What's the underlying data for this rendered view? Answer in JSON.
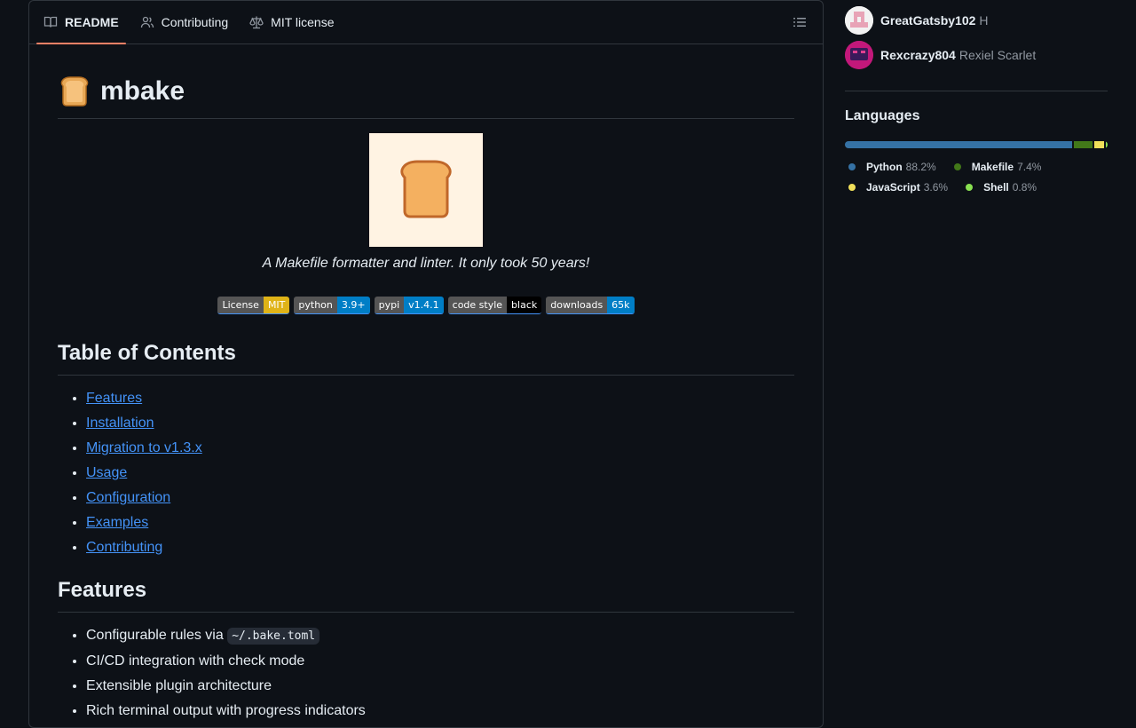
{
  "tabs": [
    {
      "label": "README",
      "icon": "book-icon",
      "active": true
    },
    {
      "label": "Contributing",
      "icon": "people-icon",
      "active": false
    },
    {
      "label": "MIT license",
      "icon": "law-icon",
      "active": false
    }
  ],
  "readme": {
    "title": "mbake",
    "tagline": "A Makefile formatter and linter. It only took 50 years!",
    "badges": [
      {
        "label": "License",
        "value": "MIT",
        "color": "#dfb317"
      },
      {
        "label": "python",
        "value": "3.9+",
        "color": "#007ec6"
      },
      {
        "label": "pypi",
        "value": "v1.4.1",
        "color": "#007ec6"
      },
      {
        "label": "code style",
        "value": "black",
        "color": "#000000"
      },
      {
        "label": "downloads",
        "value": "65k",
        "color": "#007ec6"
      }
    ],
    "toc_heading": "Table of Contents",
    "toc": [
      "Features",
      "Installation",
      "Migration to v1.3.x",
      "Usage",
      "Configuration",
      "Examples",
      "Contributing"
    ],
    "features_heading": "Features",
    "features": {
      "item1_prefix": "Configurable rules via ",
      "item1_code": "~/.bake.toml",
      "item2": "CI/CD integration with check mode",
      "item3": "Extensible plugin architecture",
      "item4": "Rich terminal output with progress indicators"
    }
  },
  "sidebar": {
    "contributors": [
      {
        "login": "GreatGatsby102",
        "name": "H"
      },
      {
        "login": "Rexcrazy804",
        "name": "Rexiel Scarlet"
      }
    ],
    "languages_heading": "Languages",
    "languages": [
      {
        "name": "Python",
        "percent": "88.2%",
        "value": 88.2,
        "color": "#3572A5"
      },
      {
        "name": "Makefile",
        "percent": "7.4%",
        "value": 7.4,
        "color": "#427819"
      },
      {
        "name": "JavaScript",
        "percent": "3.6%",
        "value": 3.6,
        "color": "#f1e05a"
      },
      {
        "name": "Shell",
        "percent": "0.8%",
        "value": 0.8,
        "color": "#89e051"
      }
    ]
  }
}
